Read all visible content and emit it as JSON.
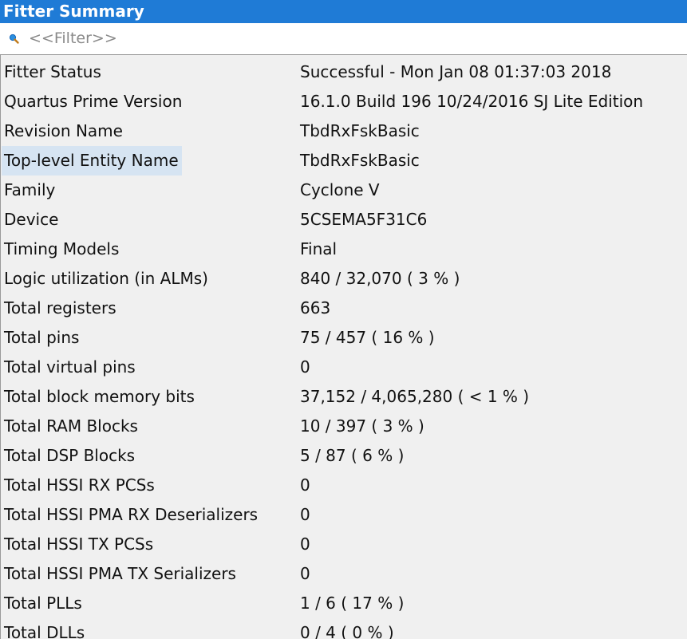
{
  "window": {
    "title": "Fitter Summary"
  },
  "filter": {
    "placeholder": "<<Filter>>",
    "value": "",
    "icon": "search-icon"
  },
  "colors": {
    "titlebar_bg": "#1f7bd6",
    "selected_row_bg": "#d6e4f2",
    "table_bg": "#f0f0f0"
  },
  "rows": [
    {
      "name": "Fitter Status",
      "value": "Successful - Mon Jan 08 01:37:03 2018"
    },
    {
      "name": "Quartus Prime Version",
      "value": "16.1.0 Build 196 10/24/2016 SJ Lite Edition"
    },
    {
      "name": "Revision Name",
      "value": "TbdRxFskBasic"
    },
    {
      "name": "Top-level Entity Name",
      "value": "TbdRxFskBasic"
    },
    {
      "name": "Family",
      "value": "Cyclone V"
    },
    {
      "name": "Device",
      "value": "5CSEMA5F31C6"
    },
    {
      "name": "Timing Models",
      "value": "Final"
    },
    {
      "name": "Logic utilization (in ALMs)",
      "value": "840 / 32,070 ( 3 % )"
    },
    {
      "name": "Total registers",
      "value": "663"
    },
    {
      "name": "Total pins",
      "value": "75 / 457 ( 16 % )"
    },
    {
      "name": "Total virtual pins",
      "value": "0"
    },
    {
      "name": "Total block memory bits",
      "value": "37,152 / 4,065,280 ( < 1 % )"
    },
    {
      "name": "Total RAM Blocks",
      "value": "10 / 397 ( 3 % )"
    },
    {
      "name": "Total DSP Blocks",
      "value": "5 / 87 ( 6 % )"
    },
    {
      "name": "Total HSSI RX PCSs",
      "value": "0"
    },
    {
      "name": "Total HSSI PMA RX Deserializers",
      "value": "0"
    },
    {
      "name": "Total HSSI TX PCSs",
      "value": "0"
    },
    {
      "name": "Total HSSI PMA TX Serializers",
      "value": "0"
    },
    {
      "name": "Total PLLs",
      "value": "1 / 6 ( 17 % )"
    },
    {
      "name": "Total DLLs",
      "value": "0 / 4 ( 0 % )"
    }
  ],
  "selected_row": 3
}
